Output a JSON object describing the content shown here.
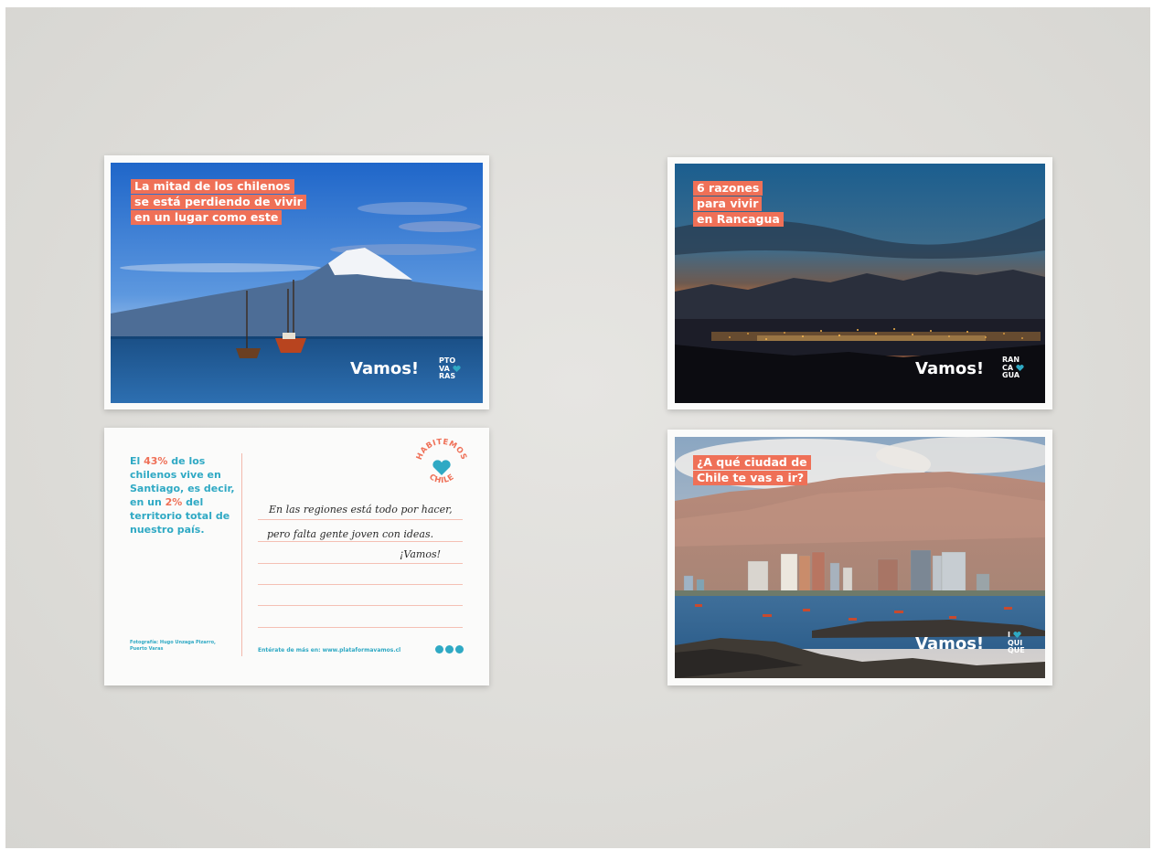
{
  "colors": {
    "accent": "#ef7057",
    "teal": "#2fa9c4",
    "background": "#dedddA"
  },
  "cards": {
    "puerto_varas": {
      "headline": [
        "La mitad de los chilenos",
        "se está perdiendo de vivir",
        "en un lugar como este"
      ],
      "vamos": "Vamos!",
      "logo": [
        "PTO",
        "VA",
        "RAS"
      ]
    },
    "rancagua": {
      "headline": [
        "6 razones",
        "para vivir",
        "en Rancagua"
      ],
      "vamos": "Vamos!",
      "logo": [
        "RAN",
        "CA",
        "GUA"
      ]
    },
    "iquique": {
      "headline": [
        "¿A qué ciudad de",
        "Chile te vas a ir?"
      ],
      "vamos": "Vamos!",
      "logo": [
        "I",
        "QUI",
        "QUE"
      ]
    },
    "back": {
      "stat_parts": [
        "El ",
        "43%",
        " de los chilenos vive en Santiago, es decir, en un ",
        "2%",
        " del territorio total de nuestro país."
      ],
      "handwriting": [
        "En las regiones está todo por hacer,",
        "pero falta gente joven con ideas.",
        "¡Vamos!"
      ],
      "stamp_text": [
        "HABITEMOS",
        "CHILE"
      ],
      "credit": [
        "Fotografía: Hugo Unzaga Pizarro,",
        "Puerto Varas"
      ],
      "footer": "Entérate de más en: www.plataformavamos.cl",
      "social_icons": [
        "facebook-icon",
        "twitter-icon",
        "instagram-icon"
      ]
    }
  }
}
